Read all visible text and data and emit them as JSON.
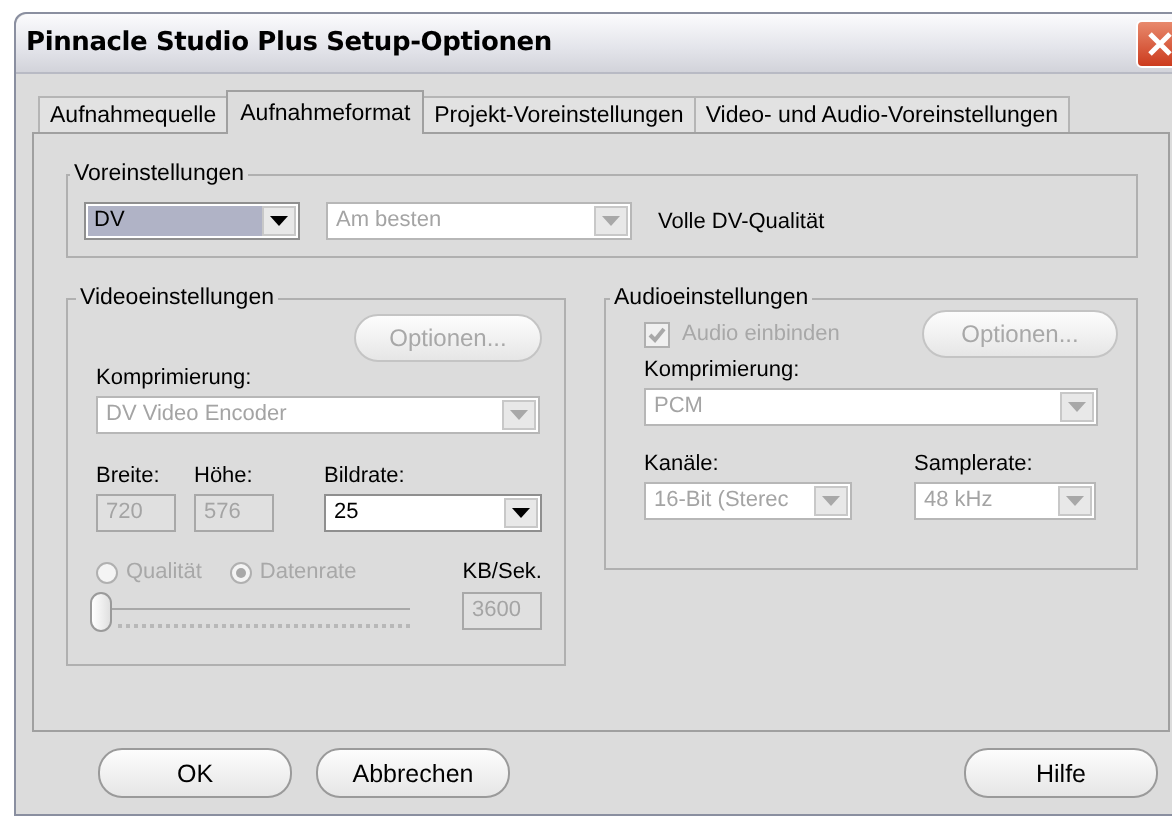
{
  "window": {
    "title": "Pinnacle Studio Plus Setup-Optionen"
  },
  "tabs": [
    {
      "label": "Aufnahmequelle",
      "selected": false
    },
    {
      "label": "Aufnahmeformat",
      "selected": true
    },
    {
      "label": "Projekt-Voreinstellungen",
      "selected": false
    },
    {
      "label": "Video- und Audio-Voreinstellungen",
      "selected": false
    }
  ],
  "presets": {
    "legend": "Voreinstellungen",
    "preset": {
      "value": "DV",
      "disabled": false
    },
    "quality": {
      "value": "Am besten",
      "disabled": true
    },
    "description": "Volle DV-Qualität"
  },
  "video": {
    "legend": "Videoeinstellungen",
    "options_button": {
      "label": "Optionen...",
      "disabled": true
    },
    "compression_label": "Komprimierung:",
    "compression": {
      "value": "DV Video Encoder",
      "disabled": true
    },
    "width_label": "Breite:",
    "width": {
      "value": "720",
      "disabled": true
    },
    "height_label": "Höhe:",
    "height": {
      "value": "576",
      "disabled": true
    },
    "framerate_label": "Bildrate:",
    "framerate": {
      "value": "25",
      "disabled": false
    },
    "modes": [
      {
        "label": "Qualität",
        "selected": false,
        "disabled": true
      },
      {
        "label": "Datenrate",
        "selected": true,
        "disabled": true
      }
    ],
    "rate_label": "KB/Sek.",
    "rate": {
      "value": "3600",
      "disabled": true
    },
    "slider": {
      "level": 0,
      "disabled": true
    }
  },
  "audio": {
    "legend": "Audioeinstellungen",
    "include": {
      "label": "Audio einbinden",
      "checked": true,
      "disabled": true
    },
    "options_button": {
      "label": "Optionen...",
      "disabled": true
    },
    "compression_label": "Komprimierung:",
    "compression": {
      "value": "PCM",
      "disabled": true
    },
    "channels_label": "Kanäle:",
    "channels": {
      "value": "16-Bit (Sterec",
      "disabled": true
    },
    "samplerate_label": "Samplerate:",
    "samplerate": {
      "value": "48 kHz",
      "disabled": true
    }
  },
  "buttons": [
    {
      "label": "OK"
    },
    {
      "label": "Abbrechen"
    },
    {
      "label": "Hilfe"
    }
  ]
}
